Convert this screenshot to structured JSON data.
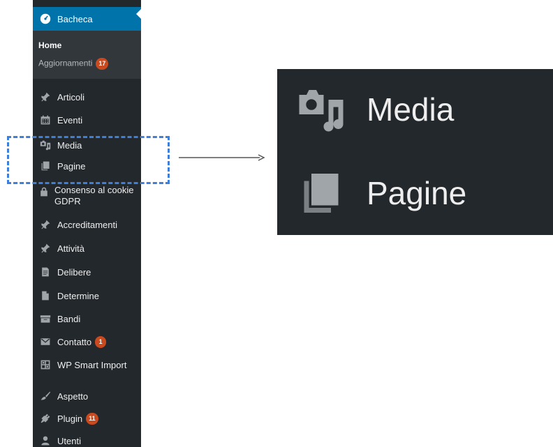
{
  "sidebar": {
    "dashboard": {
      "label": "Bacheca",
      "icon": "dashboard-icon"
    },
    "submenu": {
      "home": "Home",
      "updates": {
        "label": "Aggiornamenti",
        "badge": "17"
      }
    },
    "items": [
      {
        "label": "Articoli",
        "icon": "pushpin-icon"
      },
      {
        "label": "Eventi",
        "icon": "calendar-icon"
      },
      {
        "label": "Media",
        "icon": "media-icon"
      },
      {
        "label": "Pagine",
        "icon": "pages-icon"
      },
      {
        "label": "Consenso al cookie GDPR",
        "icon": "lock-icon"
      },
      {
        "label": "Accreditamenti",
        "icon": "pushpin-icon"
      },
      {
        "label": "Attività",
        "icon": "pushpin-icon"
      },
      {
        "label": "Delibere",
        "icon": "document-icon"
      },
      {
        "label": "Determine",
        "icon": "page-icon"
      },
      {
        "label": "Bandi",
        "icon": "archive-icon"
      },
      {
        "label": "Contatto",
        "icon": "email-icon",
        "badge": "1"
      },
      {
        "label": "WP Smart Import",
        "icon": "grid-icon"
      },
      {
        "label": "Aspetto",
        "icon": "brush-icon"
      },
      {
        "label": "Plugin",
        "icon": "plugin-icon",
        "badge": "11"
      },
      {
        "label": "Utenti",
        "icon": "users-icon"
      }
    ]
  },
  "zoom": {
    "items": [
      {
        "label": "Media",
        "icon": "media-icon"
      },
      {
        "label": "Pagine",
        "icon": "pages-icon"
      }
    ]
  },
  "colors": {
    "sidebar_bg": "#23282d",
    "submenu_bg": "#32373c",
    "active_bg": "#0073aa",
    "badge_bg": "#ca4a1f",
    "highlight": "#3d7fd9"
  }
}
